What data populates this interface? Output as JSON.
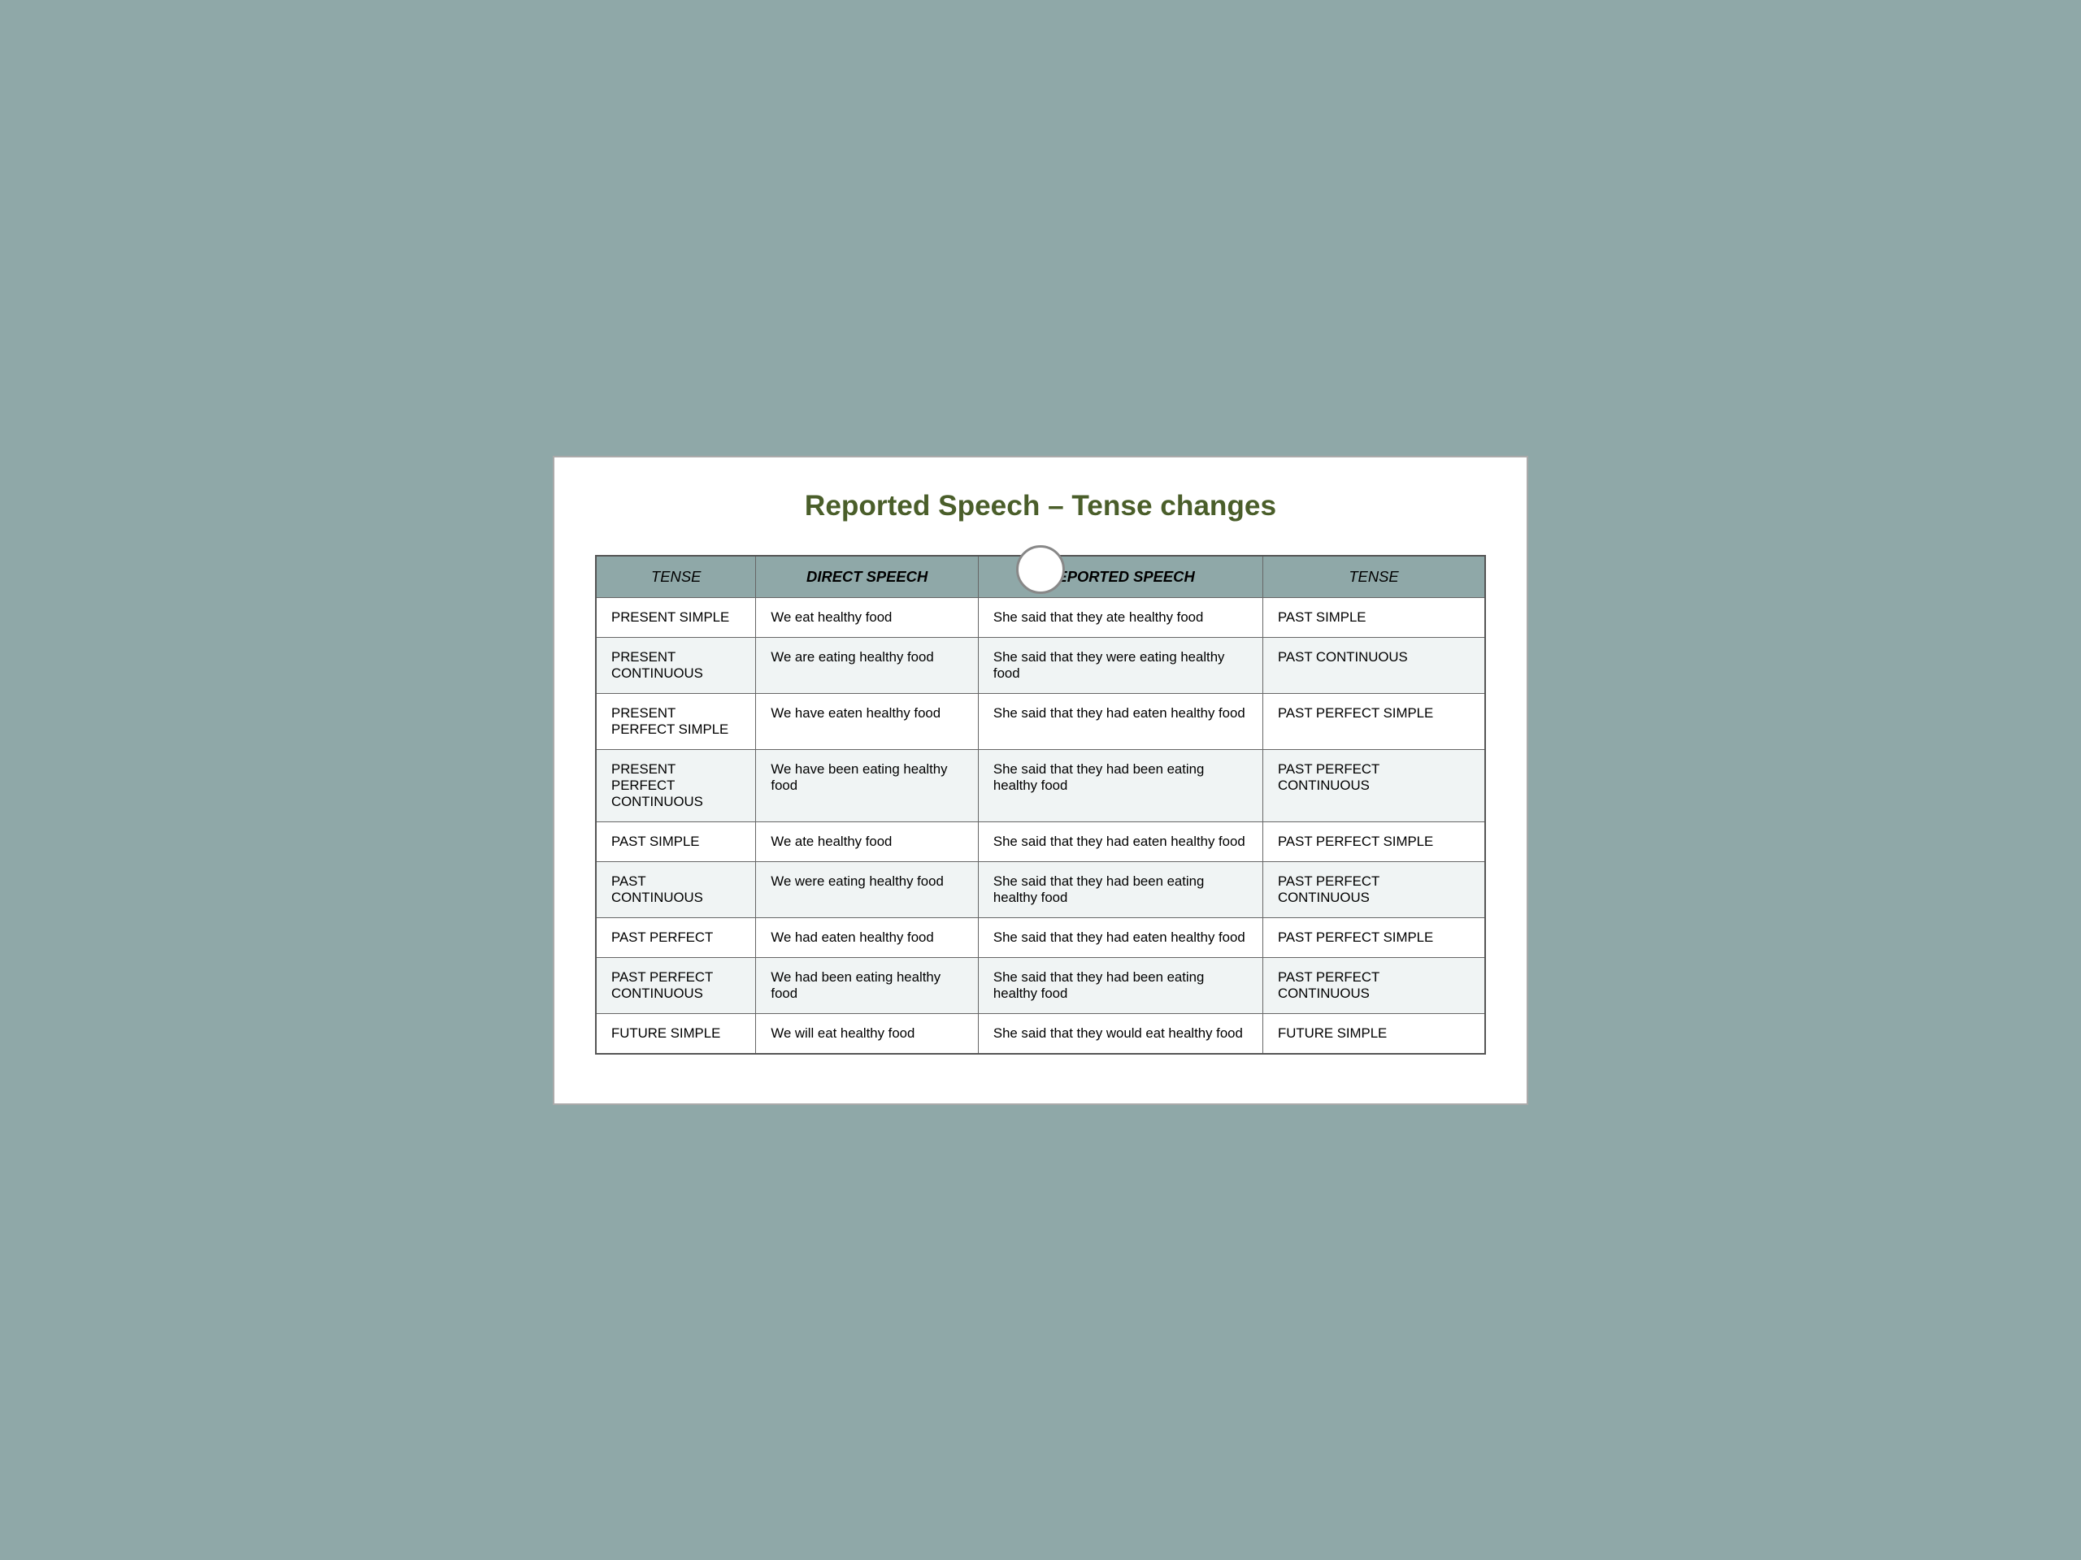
{
  "title": "Reported Speech – Tense changes",
  "headers": {
    "tense_left": "TENSE",
    "direct_speech": "DIRECT SPEECH",
    "reported_speech": "REPORTED SPEECH",
    "tense_right": "TENSE"
  },
  "rows": [
    {
      "tense_left": "PRESENT SIMPLE",
      "direct_speech": "We eat healthy food",
      "reported_speech": "She said that they ate healthy food",
      "tense_right": "PAST SIMPLE"
    },
    {
      "tense_left": "PRESENT CONTINUOUS",
      "direct_speech": "We are eating healthy food",
      "reported_speech": "She said that they were eating healthy food",
      "tense_right": "PAST CONTINUOUS"
    },
    {
      "tense_left": "PRESENT PERFECT SIMPLE",
      "direct_speech": "We have eaten healthy food",
      "reported_speech": "She said that they had eaten healthy food",
      "tense_right": "PAST PERFECT SIMPLE"
    },
    {
      "tense_left": "PRESENT PERFECT CONTINUOUS",
      "direct_speech": "We have been eating healthy food",
      "reported_speech": "She said that they had been eating  healthy food",
      "tense_right": "PAST PERFECT CONTINUOUS"
    },
    {
      "tense_left": "PAST SIMPLE",
      "direct_speech": "We ate healthy food",
      "reported_speech": "She said that they had eaten healthy food",
      "tense_right": "PAST PERFECT SIMPLE"
    },
    {
      "tense_left": "PAST CONTINUOUS",
      "direct_speech": "We were eating healthy food",
      "reported_speech": "She said that they had been eating healthy food",
      "tense_right": "PAST PERFECT CONTINUOUS"
    },
    {
      "tense_left": "PAST PERFECT",
      "direct_speech": "We had eaten healthy food",
      "reported_speech": "She said that they had eaten healthy food",
      "tense_right": "PAST PERFECT SIMPLE"
    },
    {
      "tense_left": "PAST PERFECT CONTINUOUS",
      "direct_speech": "We had been eating healthy food",
      "reported_speech": "She said that they had been eating  healthy food",
      "tense_right": "PAST PERFECT CONTINUOUS"
    },
    {
      "tense_left": "FUTURE SIMPLE",
      "direct_speech": "We will eat healthy food",
      "reported_speech": "She said that they would eat healthy food",
      "tense_right": "FUTURE SIMPLE"
    }
  ]
}
